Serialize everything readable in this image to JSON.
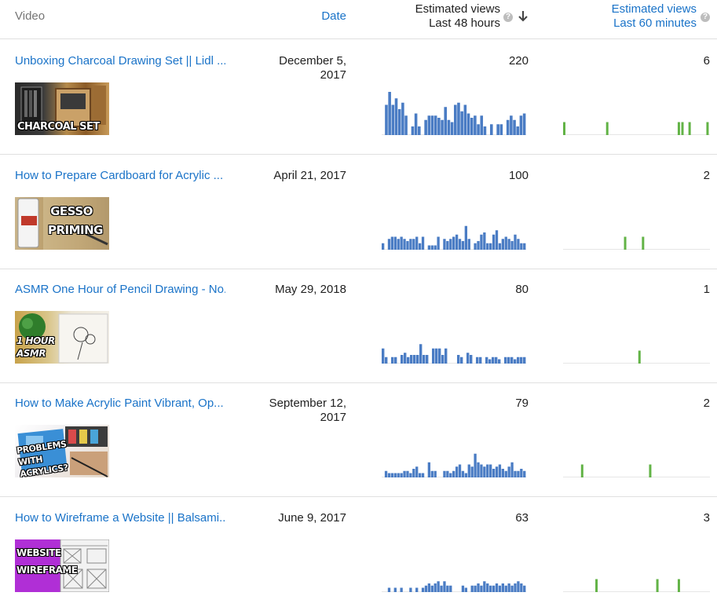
{
  "header": {
    "video_label": "Video",
    "date_label": "Date",
    "est48_line1": "Estimated views",
    "est48_line2": "Last 48 hours",
    "est60_line1": "Estimated views",
    "est60_line2": "Last 60 minutes",
    "help_glyph": "?",
    "sort_glyph": "↓"
  },
  "colors": {
    "link": "#1a73c8",
    "bar48": "#4a7cc4",
    "bar60": "#62b346",
    "divider": "#e0e0e0"
  },
  "rows": [
    {
      "title": "Unboxing Charcoal Drawing Set || Lidl ...",
      "date_line1": "December 5,",
      "date_line2": "2017",
      "views_48h": "220",
      "views_60m": "6",
      "thumb_text": "CHARCOAL SET",
      "spark48": [
        0,
        0.7,
        1,
        0.7,
        0.85,
        0.6,
        0.75,
        0.45,
        0,
        0.2,
        0.5,
        0.2,
        0,
        0.35,
        0.45,
        0.45,
        0.45,
        0.4,
        0.35,
        0.65,
        0.35,
        0.3,
        0.7,
        0.75,
        0.55,
        0.7,
        0.5,
        0.4,
        0.45,
        0.25,
        0.45,
        0.2,
        0,
        0.25,
        0,
        0.25,
        0.25,
        0,
        0.35,
        0.45,
        0.35,
        0.2,
        0.45,
        0.5
      ],
      "spark60": [
        0.3,
        0,
        0,
        0,
        0,
        0,
        0,
        0,
        0,
        0,
        0,
        0,
        0.3,
        0,
        0,
        0,
        0,
        0,
        0,
        0,
        0,
        0,
        0,
        0,
        0,
        0,
        0,
        0,
        0,
        0,
        0,
        0,
        0.3,
        0.3,
        0,
        0.3,
        0,
        0,
        0,
        0,
        0.3
      ]
    },
    {
      "title": "How to Prepare Cardboard for Acrylic ...",
      "date_line1": "April 21, 2017",
      "date_line2": "",
      "views_48h": "100",
      "views_60m": "2",
      "thumb_text": "GESSO PRIMING",
      "spark48": [
        0.15,
        0,
        0.25,
        0.3,
        0.3,
        0.25,
        0.3,
        0.25,
        0.2,
        0.25,
        0.25,
        0.3,
        0.15,
        0.3,
        0,
        0.1,
        0.1,
        0.1,
        0.3,
        0,
        0.25,
        0.2,
        0.25,
        0.3,
        0.35,
        0.25,
        0.2,
        0.55,
        0.25,
        0,
        0.15,
        0.2,
        0.35,
        0.4,
        0.15,
        0.15,
        0.35,
        0.45,
        0.15,
        0.25,
        0.3,
        0.25,
        0.2,
        0.35,
        0.25,
        0.15,
        0.15
      ],
      "spark60": [
        0,
        0,
        0,
        0,
        0,
        0,
        0,
        0,
        0,
        0,
        0,
        0,
        0,
        0,
        0,
        0,
        0,
        0.3,
        0,
        0,
        0,
        0,
        0.3,
        0,
        0,
        0,
        0,
        0,
        0,
        0,
        0,
        0,
        0,
        0,
        0,
        0,
        0,
        0,
        0,
        0,
        0
      ]
    },
    {
      "title": "ASMR One Hour of Pencil Drawing - No...",
      "date_line1": "May 29, 2018",
      "date_line2": "",
      "views_48h": "80",
      "views_60m": "1",
      "thumb_text": "1 HOUR ASMR",
      "spark48": [
        0.35,
        0.15,
        0,
        0.15,
        0.15,
        0,
        0.2,
        0.25,
        0.15,
        0.2,
        0.2,
        0.2,
        0.45,
        0.2,
        0.2,
        0,
        0.35,
        0.35,
        0.35,
        0.2,
        0.35,
        0,
        0,
        0,
        0.2,
        0.15,
        0,
        0.25,
        0.2,
        0,
        0.15,
        0.15,
        0,
        0.15,
        0.1,
        0.15,
        0.15,
        0.1,
        0,
        0.15,
        0.15,
        0.15,
        0.1,
        0.15,
        0.15,
        0.15
      ],
      "spark60": [
        0,
        0,
        0,
        0,
        0,
        0,
        0,
        0,
        0,
        0,
        0,
        0,
        0,
        0,
        0,
        0,
        0,
        0,
        0,
        0,
        0,
        0.3,
        0,
        0,
        0,
        0,
        0,
        0,
        0,
        0,
        0,
        0,
        0,
        0,
        0,
        0,
        0,
        0,
        0,
        0,
        0
      ]
    },
    {
      "title": "How to Make Acrylic Paint Vibrant, Op...",
      "date_line1": "September 12,",
      "date_line2": "2017",
      "views_48h": "79",
      "views_60m": "2",
      "thumb_text": "PROBLEMS WITH ACRYLICS?",
      "spark48": [
        0,
        0.15,
        0.1,
        0.1,
        0.1,
        0.1,
        0.1,
        0.15,
        0.15,
        0.1,
        0.2,
        0.25,
        0.1,
        0.1,
        0,
        0.35,
        0.15,
        0.15,
        0,
        0,
        0.15,
        0.15,
        0.1,
        0.15,
        0.25,
        0.3,
        0.15,
        0.1,
        0.3,
        0.25,
        0.55,
        0.35,
        0.3,
        0.25,
        0.3,
        0.3,
        0.2,
        0.25,
        0.3,
        0.2,
        0.15,
        0.25,
        0.35,
        0.15,
        0.15,
        0.2,
        0.15
      ],
      "spark60": [
        0,
        0,
        0,
        0,
        0,
        0.3,
        0,
        0,
        0,
        0,
        0,
        0,
        0,
        0,
        0,
        0,
        0,
        0,
        0,
        0,
        0,
        0,
        0,
        0,
        0.3,
        0,
        0,
        0,
        0,
        0,
        0,
        0,
        0,
        0,
        0,
        0,
        0,
        0,
        0,
        0,
        0
      ]
    },
    {
      "title": "How to Wireframe a Website || Balsami...",
      "date_line1": "June 9, 2017",
      "date_line2": "",
      "views_48h": "63",
      "views_60m": "3",
      "thumb_text": "WEBSITE WIREFRAME",
      "spark48": [
        0,
        0,
        0.1,
        0,
        0.1,
        0,
        0.1,
        0,
        0,
        0.1,
        0,
        0.1,
        0,
        0.1,
        0.15,
        0.2,
        0.15,
        0.2,
        0.25,
        0.15,
        0.25,
        0.15,
        0.15,
        0,
        0,
        0,
        0.15,
        0.1,
        0,
        0.15,
        0.15,
        0.2,
        0.15,
        0.25,
        0.2,
        0.15,
        0.15,
        0.2,
        0.15,
        0.2,
        0.15,
        0.2,
        0.15,
        0.2,
        0.25,
        0.2,
        0.15
      ],
      "spark60": [
        0,
        0,
        0,
        0,
        0,
        0,
        0,
        0,
        0,
        0.3,
        0,
        0,
        0,
        0,
        0,
        0,
        0,
        0,
        0,
        0,
        0,
        0,
        0,
        0,
        0,
        0,
        0.3,
        0,
        0,
        0,
        0,
        0,
        0.3,
        0,
        0,
        0,
        0,
        0,
        0,
        0,
        0
      ]
    }
  ]
}
